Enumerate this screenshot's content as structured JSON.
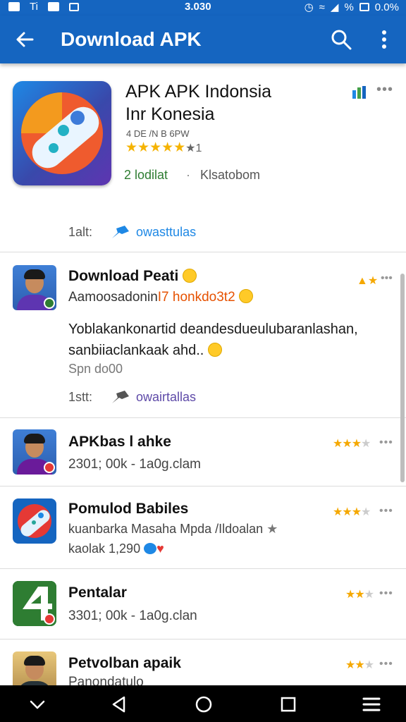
{
  "status_bar": {
    "left_text": "Ti",
    "time": "3.030",
    "battery_text": "%",
    "right_text": "0.0%"
  },
  "app_bar": {
    "title": "Download APK",
    "icons": [
      "back-arrow-icon",
      "search-icon",
      "more-vert-icon"
    ]
  },
  "featured": {
    "name_line1": "APK APK Indonsia",
    "name_line2": "Inr Konesia",
    "meta": "4 DE /N B 6PW",
    "stars": "★★★★★",
    "rating_suffix": "★1",
    "installs": "2 lodilat",
    "separator": "·",
    "publisher": "Klsatobom",
    "share_label": "1alt:",
    "share_link": "owasttulas",
    "accent_color": "#1565c0"
  },
  "post": {
    "title": "Download Peati",
    "subtitle_prefix": "Aamoosadonin",
    "subtitle_highlight": "I7 honkdo3t2",
    "body_line1": "Yoblakankonartid deandesdueulubaranlashan,",
    "body_line2": "sanbiiaclankaak ahd..",
    "time": "Spn do00",
    "share_label": "1stt:",
    "share_link": "owairtallas"
  },
  "list": [
    {
      "name": "APKbas l ahke",
      "sub": "2301; 00k - 1a0g.clam",
      "rating": "★★★",
      "rating_half": "★"
    },
    {
      "name": "Pomulod Babiles",
      "sub": "kuanbarka Masaha Mpda /Ildoalan",
      "sub2": "kaolak 1,290",
      "rating": "★★★",
      "rating_half": "★"
    },
    {
      "name": "Pentalar",
      "sub": "3301; 00k - 1a0g.clan",
      "rating": "★★",
      "rating_half": "★"
    },
    {
      "name": "Petvolban apaik",
      "sub": "Panondatulo",
      "rating": "★★",
      "rating_half": "★"
    }
  ],
  "menu_dots": "•••",
  "nav_bar": {
    "icons": [
      "chevron-down-icon",
      "back-triangle-icon",
      "home-circle-icon",
      "recents-square-icon",
      "menu-lines-icon"
    ]
  }
}
